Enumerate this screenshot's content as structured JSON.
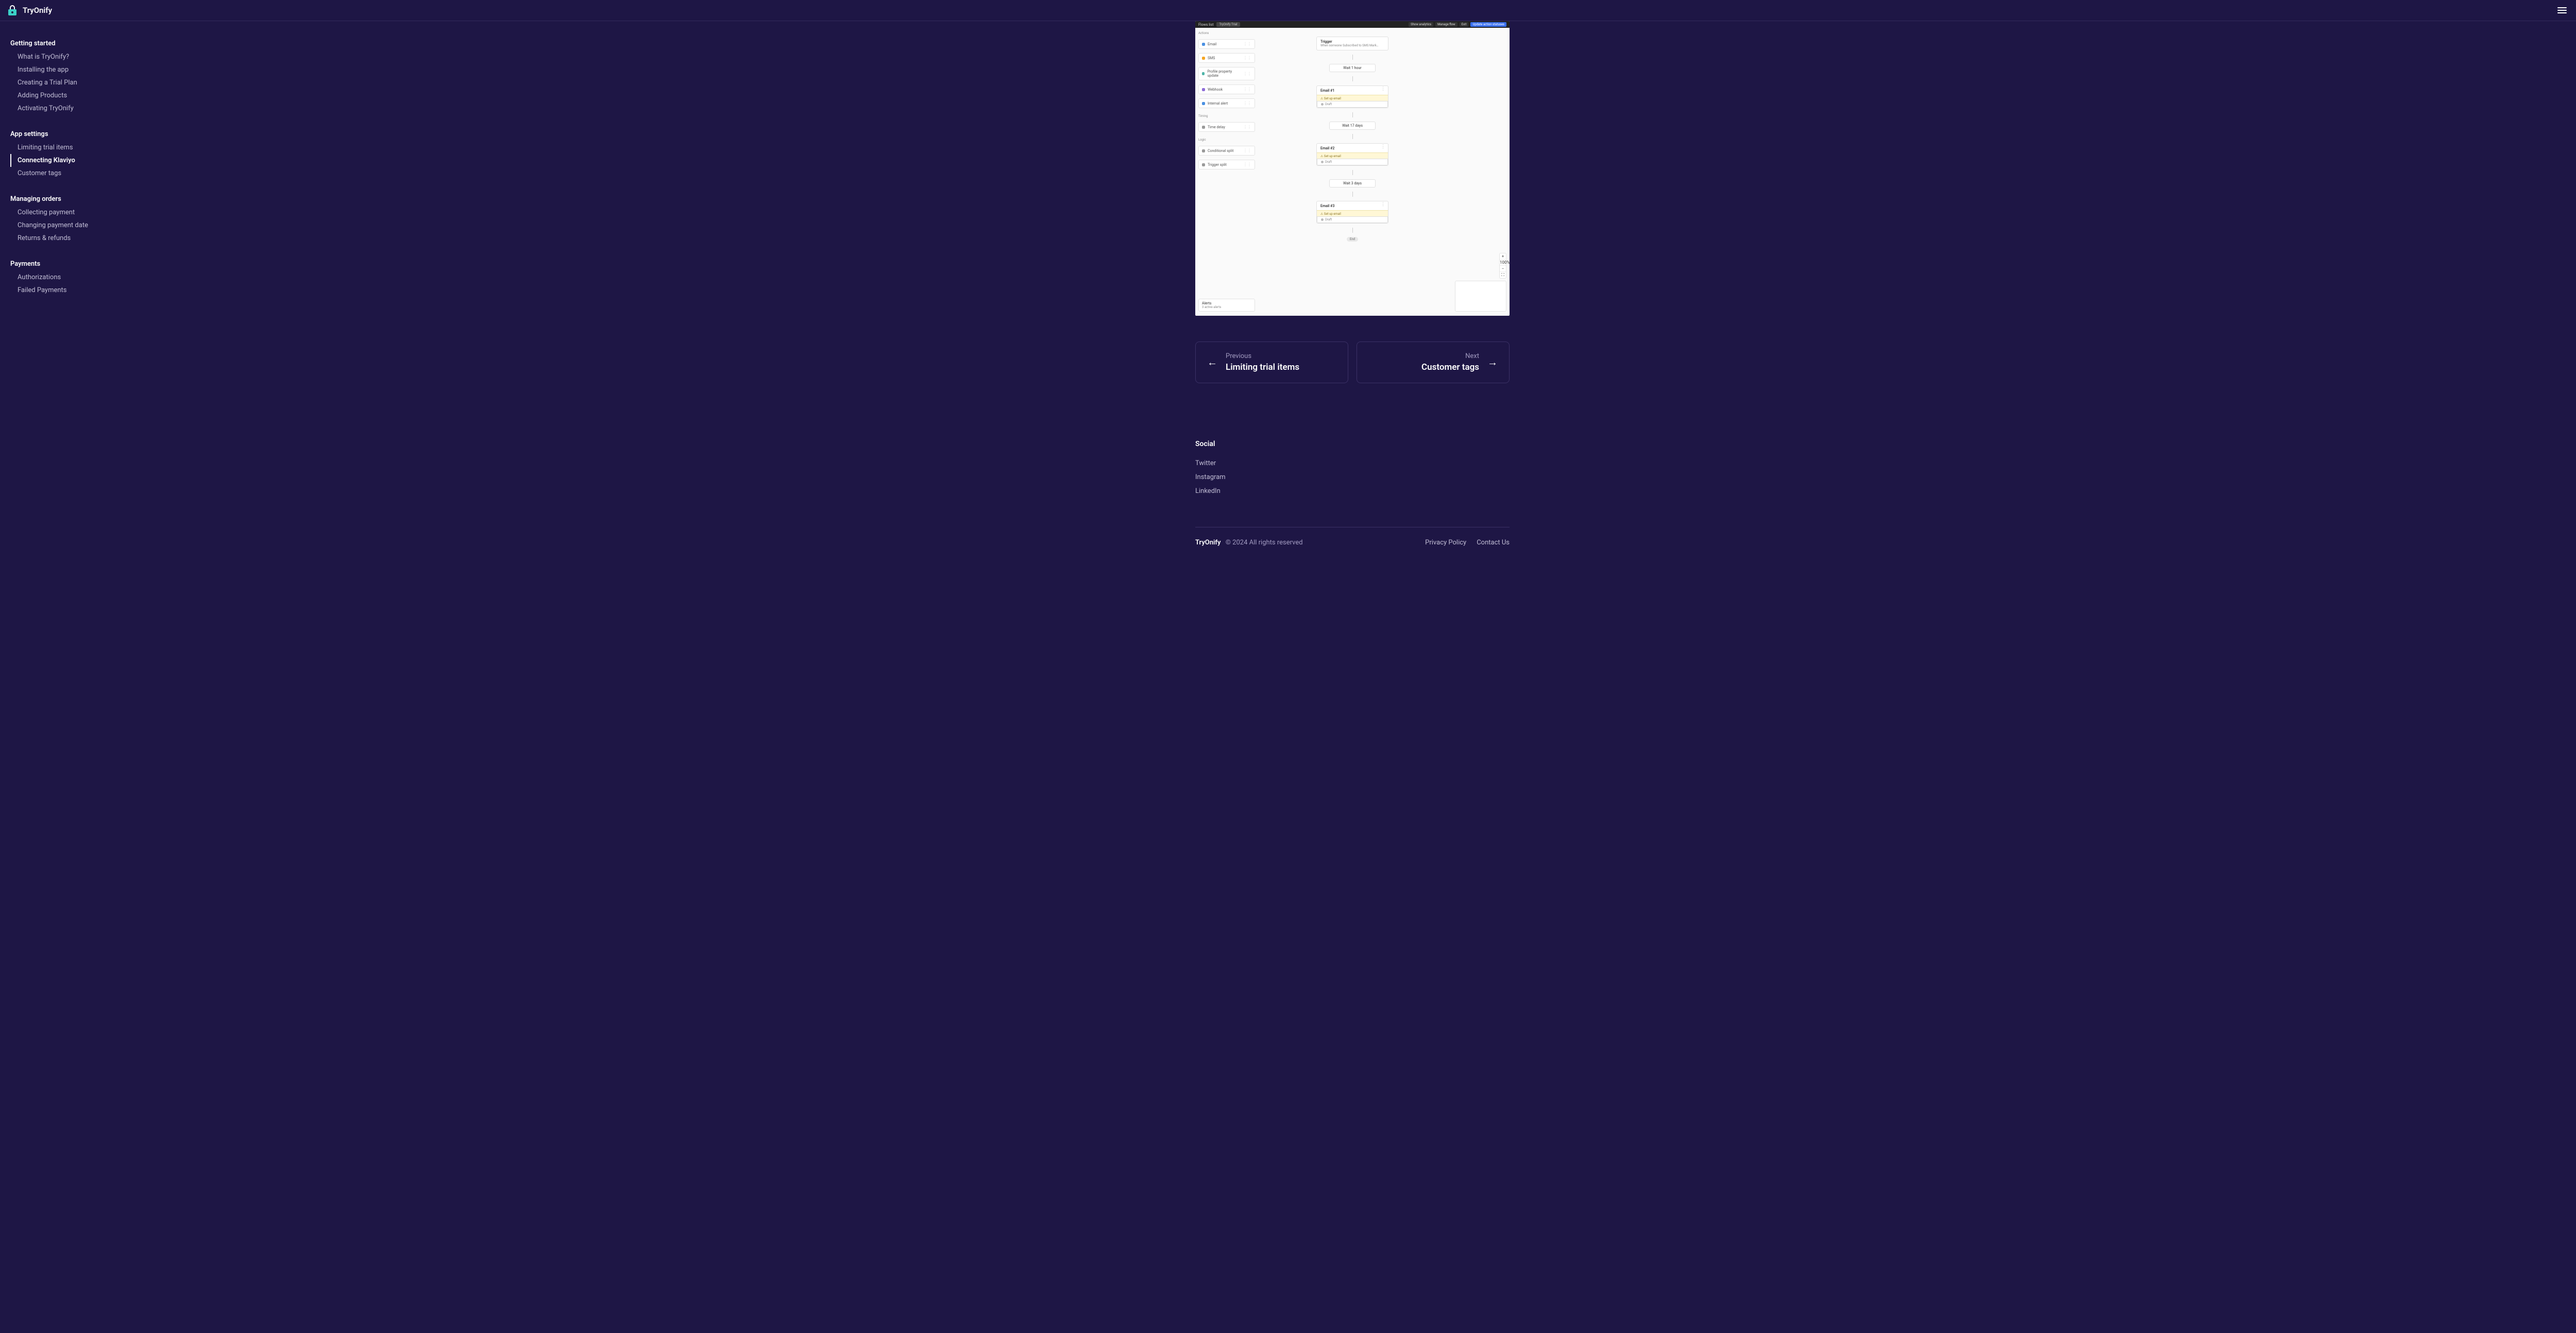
{
  "header": {
    "brand": "TryOnify"
  },
  "sidebar": {
    "groups": [
      {
        "heading": "Getting started",
        "items": [
          "What is TryOnify?",
          "Installing the app",
          "Creating a Trial Plan",
          "Adding Products",
          "Activating TryOnify"
        ]
      },
      {
        "heading": "App settings",
        "items": [
          "Limiting trial items",
          "Connecting Klaviyo",
          "Customer tags"
        ],
        "activeIndex": 1
      },
      {
        "heading": "Managing orders",
        "items": [
          "Collecting payment",
          "Changing payment date",
          "Returns & refunds"
        ]
      },
      {
        "heading": "Payments",
        "items": [
          "Authorizations",
          "Failed Payments"
        ]
      }
    ]
  },
  "flow": {
    "topbar": {
      "back": "Flows list",
      "badge": "TryOnify Trial",
      "buttons": [
        "Show analytics",
        "Manage flow",
        "Exit",
        "Update action statuses"
      ]
    },
    "sidePanels": {
      "actions": {
        "title": "Actions",
        "items": [
          {
            "color": "blue",
            "label": "Email"
          },
          {
            "color": "orange",
            "label": "SMS"
          },
          {
            "color": "teal",
            "label": "Profile property update"
          },
          {
            "color": "purple",
            "label": "Webhook"
          },
          {
            "color": "blue",
            "label": "Internal alert"
          }
        ]
      },
      "timing": {
        "title": "Timing",
        "items": [
          {
            "color": "gray",
            "label": "Time delay"
          }
        ]
      },
      "logic": {
        "title": "Logic",
        "items": [
          {
            "color": "gray",
            "label": "Conditional split"
          },
          {
            "color": "gray",
            "label": "Trigger split"
          }
        ]
      }
    },
    "nodes": {
      "trigger": {
        "title": "Trigger",
        "sub": "When someone Subscribed to SMS Mark…"
      },
      "wait1": "Wait 1 hour",
      "email1": {
        "title": "Email #1",
        "warn": "Set up email",
        "draft": "Draft"
      },
      "wait2": "Wait 17 days",
      "email2": {
        "title": "Email #2",
        "warn": "Set up email",
        "draft": "Draft"
      },
      "wait3": "Wait 3 days",
      "email3": {
        "title": "Email #3",
        "warn": "Set up email",
        "draft": "Draft"
      },
      "end": "End"
    },
    "alerts": {
      "title": "Alerts",
      "sub": "3 active alerts"
    },
    "zoom": [
      "+",
      "100%",
      "−",
      "⛶"
    ]
  },
  "pager": {
    "prev": {
      "label": "Previous",
      "title": "Limiting trial items"
    },
    "next": {
      "label": "Next",
      "title": "Customer tags"
    }
  },
  "footer": {
    "socialHeading": "Social",
    "social": [
      "Twitter",
      "Instagram",
      "LinkedIn"
    ],
    "brand": "TryOnify",
    "copy": "© 2024 All rights reserved",
    "links": [
      "Privacy Policy",
      "Contact Us"
    ]
  }
}
